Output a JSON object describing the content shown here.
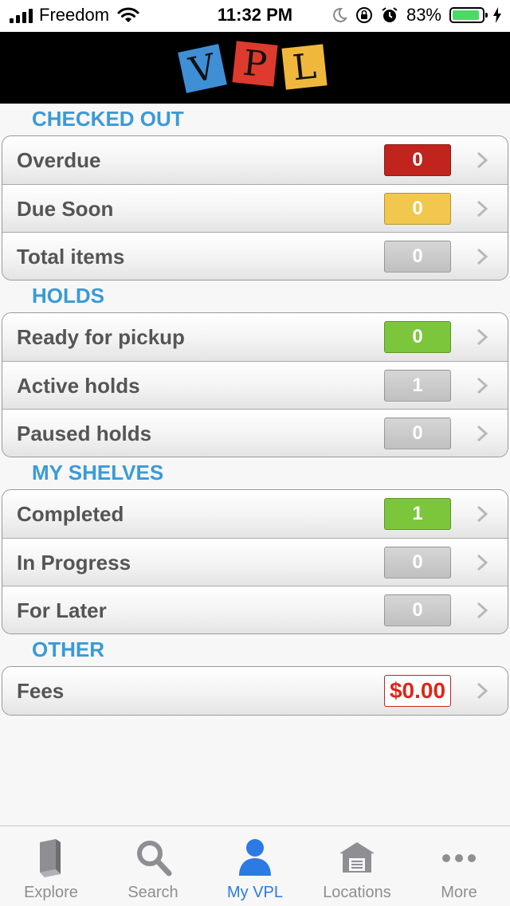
{
  "status_bar": {
    "carrier": "Freedom",
    "time": "11:32 PM",
    "battery_percent": "83%",
    "battery_level": 0.83
  },
  "header": {
    "logo": "VPL",
    "logo_letters": [
      "V",
      "P",
      "L"
    ]
  },
  "sections": {
    "checked_out": {
      "title": "CHECKED OUT",
      "rows": [
        {
          "label": "Overdue",
          "value": "0",
          "color": "#c0241c"
        },
        {
          "label": "Due Soon",
          "value": "0",
          "color": "#f1c84d"
        },
        {
          "label": "Total items",
          "value": "0",
          "color": "#c8c8c8"
        }
      ]
    },
    "holds": {
      "title": "HOLDS",
      "rows": [
        {
          "label": "Ready for pickup",
          "value": "0",
          "color": "#7cc63b"
        },
        {
          "label": "Active holds",
          "value": "1",
          "color": "#c8c8c8"
        },
        {
          "label": "Paused holds",
          "value": "0",
          "color": "#c8c8c8"
        }
      ]
    },
    "my_shelves": {
      "title": "MY SHELVES",
      "rows": [
        {
          "label": "Completed",
          "value": "1",
          "color": "#7cc63b"
        },
        {
          "label": "In Progress",
          "value": "0",
          "color": "#c8c8c8"
        },
        {
          "label": "For Later",
          "value": "0",
          "color": "#c8c8c8"
        }
      ]
    },
    "other": {
      "title": "OTHER",
      "rows": [
        {
          "label": "Fees",
          "value": "$0.00",
          "color": "#e0251b"
        }
      ]
    }
  },
  "tabbar": {
    "tabs": [
      {
        "label": "Explore",
        "icon": "book-icon"
      },
      {
        "label": "Search",
        "icon": "search-icon"
      },
      {
        "label": "My VPL",
        "icon": "person-icon",
        "active": true
      },
      {
        "label": "Locations",
        "icon": "library-building-icon"
      },
      {
        "label": "More",
        "icon": "more-dots-icon"
      }
    ],
    "active_color": "#2c7be5",
    "inactive_color": "#8e8e93"
  }
}
